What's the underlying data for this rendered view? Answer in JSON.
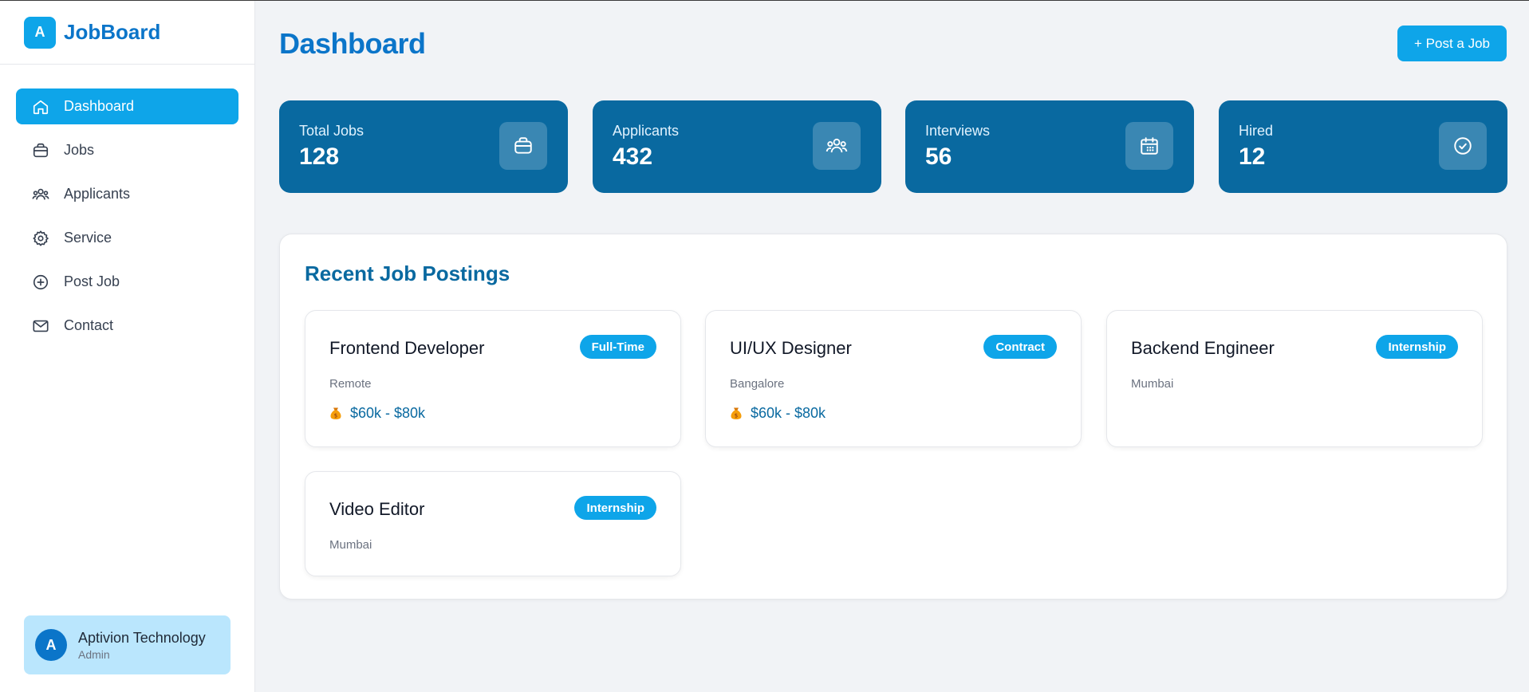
{
  "app": {
    "name": "JobBoard",
    "logo_letter": "A"
  },
  "sidebar": {
    "items": [
      {
        "label": "Dashboard",
        "icon": "home-icon",
        "active": true
      },
      {
        "label": "Jobs",
        "icon": "briefcase-icon"
      },
      {
        "label": "Applicants",
        "icon": "users-icon"
      },
      {
        "label": "Service",
        "icon": "gear-icon"
      },
      {
        "label": "Post Job",
        "icon": "plus-circle-icon"
      },
      {
        "label": "Contact",
        "icon": "mail-icon"
      }
    ],
    "profile": {
      "initial": "A",
      "name": "Aptivion Technology",
      "role": "Admin"
    }
  },
  "header": {
    "title": "Dashboard",
    "post_button": "+ Post a Job"
  },
  "stats": [
    {
      "label": "Total Jobs",
      "value": "128",
      "icon": "briefcase-icon"
    },
    {
      "label": "Applicants",
      "value": "432",
      "icon": "users-icon"
    },
    {
      "label": "Interviews",
      "value": "56",
      "icon": "calendar-icon"
    },
    {
      "label": "Hired",
      "value": "12",
      "icon": "check-circle-icon"
    }
  ],
  "recent": {
    "title": "Recent Job Postings",
    "jobs": [
      {
        "title": "Frontend Developer",
        "badge": "Full-Time",
        "location": "Remote",
        "salary": "$60k - $80k"
      },
      {
        "title": "UI/UX Designer",
        "badge": "Contract",
        "location": "Bangalore",
        "salary": "$60k - $80k"
      },
      {
        "title": "Backend Engineer",
        "badge": "Internship",
        "location": "Mumbai"
      },
      {
        "title": "Video Editor",
        "badge": "Internship",
        "location": "Mumbai"
      }
    ]
  },
  "colors": {
    "accent": "#0ea5e9",
    "brand": "#0b75c9",
    "card_dark": "#0969a0",
    "profile_bg": "#bae6fd"
  }
}
